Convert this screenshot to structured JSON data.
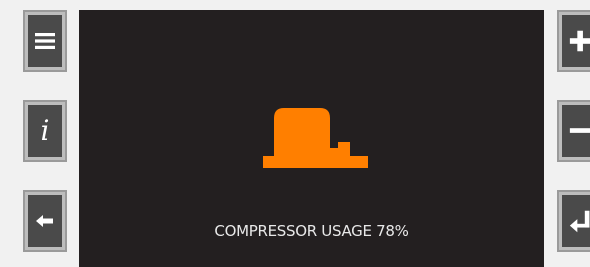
{
  "left_buttons": [
    {
      "name": "menu",
      "icon": "hamburger-menu-icon"
    },
    {
      "name": "info",
      "icon": "info-icon",
      "glyph": "i"
    },
    {
      "name": "back",
      "icon": "arrow-left-icon"
    }
  ],
  "right_buttons": [
    {
      "name": "increase",
      "icon": "plus-icon"
    },
    {
      "name": "decrease",
      "icon": "minus-icon"
    },
    {
      "name": "enter",
      "icon": "enter-return-icon"
    }
  ],
  "display": {
    "icon": "compressor-icon",
    "status_text": "COMPRESSOR USAGE 78%"
  },
  "colors": {
    "screen_bg": "#231f20",
    "accent": "#ff7f00",
    "text": "#e8e8e8",
    "button_face": "#4a4a4a"
  }
}
